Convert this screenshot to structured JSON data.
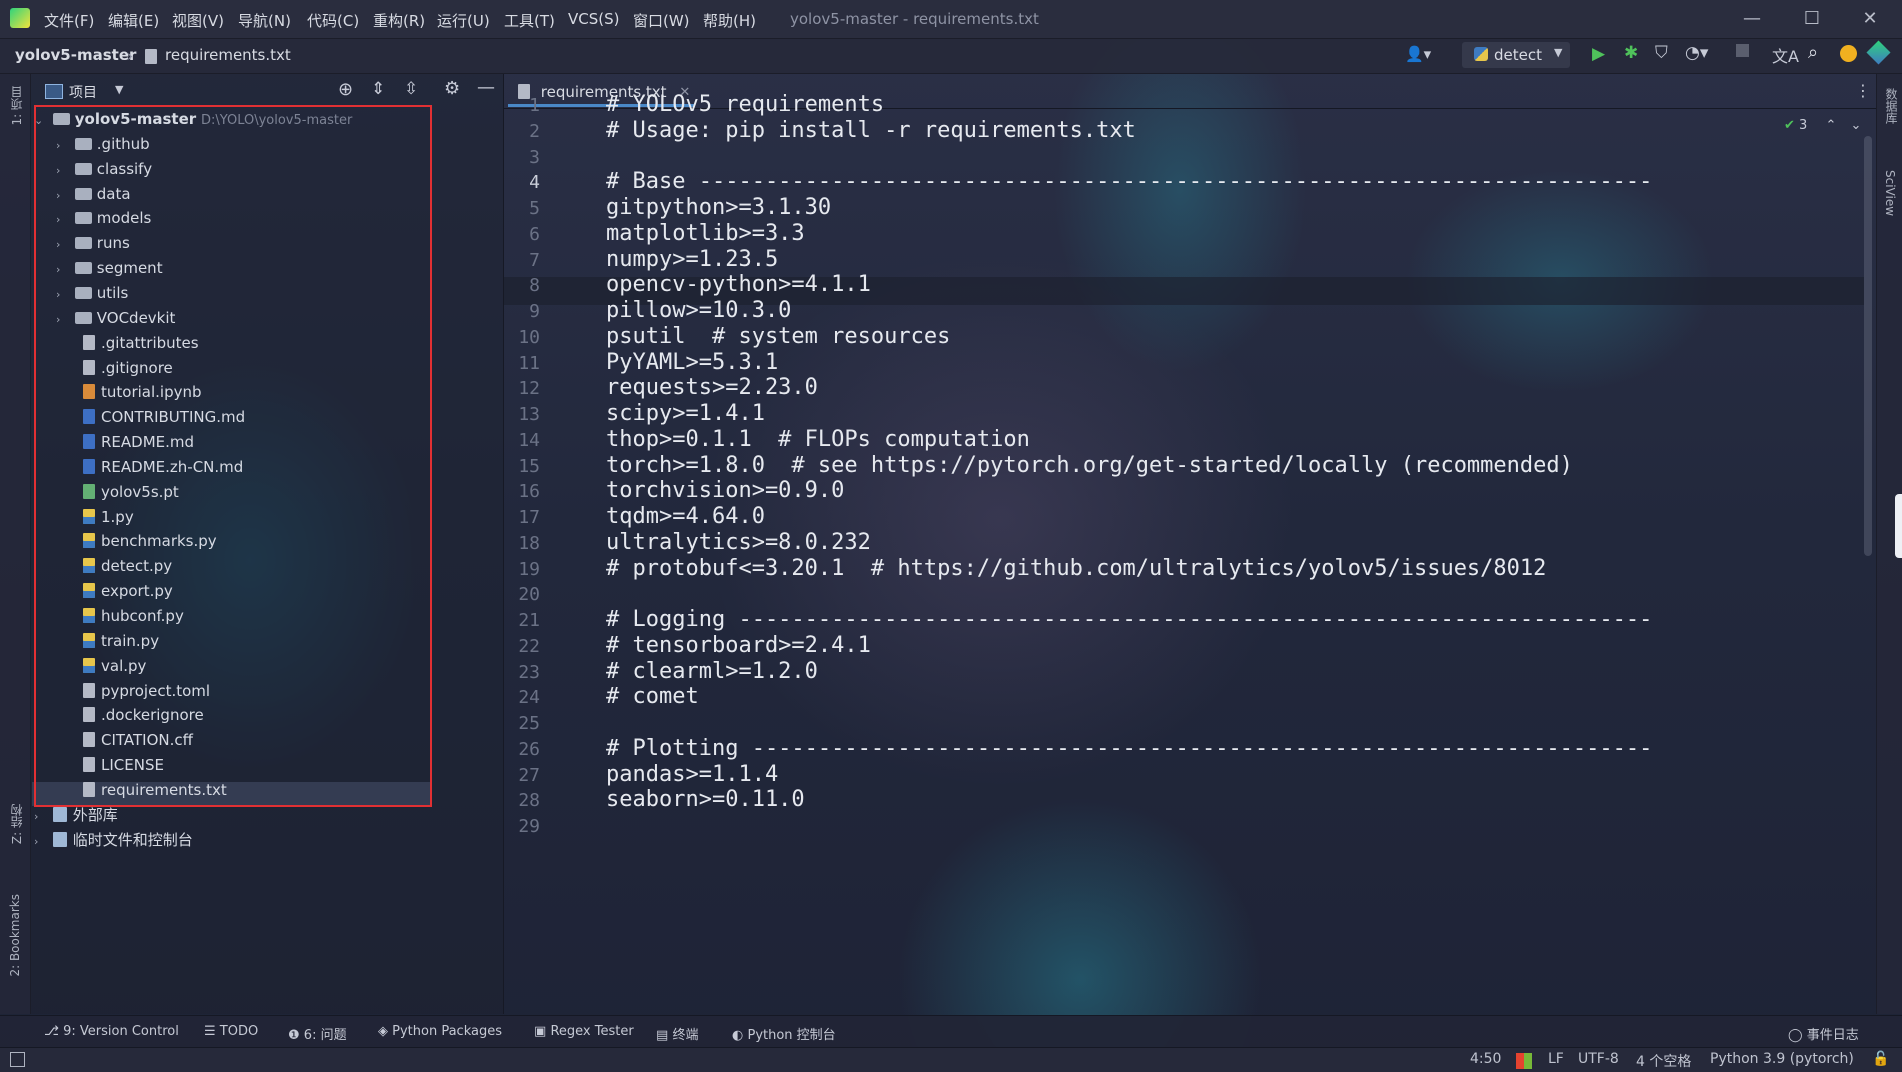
{
  "window": {
    "title": "yolov5-master - requirements.txt",
    "menu": [
      "文件(F)",
      "编辑(E)",
      "视图(V)",
      "导航(N)",
      "代码(C)",
      "重构(R)",
      "运行(U)",
      "工具(T)",
      "VCS(S)",
      "窗口(W)",
      "帮助(H)"
    ]
  },
  "nav": {
    "project": "yolov5-master",
    "file": "requirements.txt",
    "run_config": "detect"
  },
  "project_panel": {
    "title": "项目",
    "root": {
      "name": "yolov5-master",
      "path": "D:\\YOLO\\yolov5-master"
    },
    "folders": [
      ".github",
      "classify",
      "data",
      "models",
      "runs",
      "segment",
      "utils",
      "VOCdevkit"
    ],
    "files": [
      {
        "name": ".gitattributes",
        "kind": "txt"
      },
      {
        "name": ".gitignore",
        "kind": "txt"
      },
      {
        "name": "tutorial.ipynb",
        "kind": "nb"
      },
      {
        "name": "CONTRIBUTING.md",
        "kind": "md"
      },
      {
        "name": "README.md",
        "kind": "md"
      },
      {
        "name": "README.zh-CN.md",
        "kind": "md"
      },
      {
        "name": "yolov5s.pt",
        "kind": "pt"
      },
      {
        "name": "1.py",
        "kind": "py"
      },
      {
        "name": "benchmarks.py",
        "kind": "py"
      },
      {
        "name": "detect.py",
        "kind": "py"
      },
      {
        "name": "export.py",
        "kind": "py"
      },
      {
        "name": "hubconf.py",
        "kind": "py"
      },
      {
        "name": "train.py",
        "kind": "py"
      },
      {
        "name": "val.py",
        "kind": "py"
      },
      {
        "name": "pyproject.toml",
        "kind": "txt"
      },
      {
        "name": ".dockerignore",
        "kind": "txt"
      },
      {
        "name": "CITATION.cff",
        "kind": "txt"
      },
      {
        "name": "LICENSE",
        "kind": "txt"
      },
      {
        "name": "requirements.txt",
        "kind": "txt"
      }
    ],
    "extra": [
      "外部库",
      "临时文件和控制台"
    ]
  },
  "left_strip": {
    "project": "1: 项目",
    "structure": "Z: 结构",
    "bookmarks": "2: Bookmarks"
  },
  "right_strip": {
    "database": "数据库",
    "sciview": "SciView"
  },
  "editor": {
    "tab": "requirements.txt",
    "inspections": "3",
    "current_line": 4,
    "lines": [
      "# YOLOv5 requirements",
      "# Usage: pip install -r requirements.txt",
      "",
      "# Base ------------------------------------------------------------------------",
      "gitpython>=3.1.30",
      "matplotlib>=3.3",
      "numpy>=1.23.5",
      "opencv-python>=4.1.1",
      "pillow>=10.3.0",
      "psutil  # system resources",
      "PyYAML>=5.3.1",
      "requests>=2.23.0",
      "scipy>=1.4.1",
      "thop>=0.1.1  # FLOPs computation",
      "torch>=1.8.0  # see https://pytorch.org/get-started/locally (recommended)",
      "torchvision>=0.9.0",
      "tqdm>=4.64.0",
      "ultralytics>=8.0.232",
      "# protobuf<=3.20.1  # https://github.com/ultralytics/yolov5/issues/8012",
      "",
      "# Logging ---------------------------------------------------------------------",
      "# tensorboard>=2.4.1",
      "# clearml>=1.2.0",
      "# comet",
      "",
      "# Plotting --------------------------------------------------------------------",
      "pandas>=1.1.4",
      "seaborn>=0.11.0",
      ""
    ]
  },
  "toolwindows": [
    {
      "label": "9: Version Control",
      "icon": "branch-icon"
    },
    {
      "label": "TODO",
      "icon": "list-icon"
    },
    {
      "label": "6: 问题",
      "icon": "problems-icon"
    },
    {
      "label": "Python Packages",
      "icon": "packages-icon"
    },
    {
      "label": "Regex Tester",
      "icon": "regex-icon"
    },
    {
      "label": "终端",
      "icon": "terminal-icon"
    },
    {
      "label": "Python 控制台",
      "icon": "python-console-icon"
    }
  ],
  "event_log": "事件日志",
  "status": {
    "position": "4:50",
    "line_sep": "LF",
    "encoding": "UTF-8",
    "indent": "4 个空格",
    "interpreter": "Python 3.9 (pytorch)"
  },
  "colors": {
    "accent": "#4a88c7",
    "highlight_box": "#e23033",
    "run_green": "#4fc25b"
  }
}
